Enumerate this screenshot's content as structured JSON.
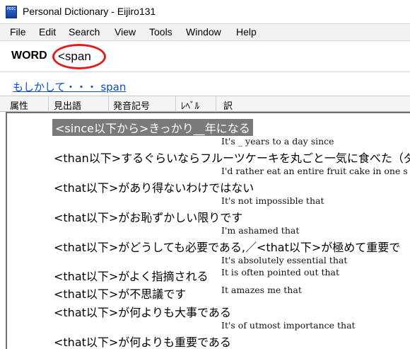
{
  "window": {
    "title": "Personal Dictionary - Eijiro131",
    "icon_label": "PDIC"
  },
  "menu": [
    "File",
    "Edit",
    "Search",
    "View",
    "Tools",
    "Window",
    "Help"
  ],
  "search": {
    "label": "WORD",
    "value": "<span",
    "annotation_color": "#e41b1b"
  },
  "suggestion": {
    "text": "もしかして・・・ span"
  },
  "columns": [
    "属性",
    "見出語",
    "発音記号",
    "ﾚﾍﾞﾙ",
    "訳"
  ],
  "entries": [
    {
      "headword": "<since以下から>きっかり__年になる",
      "translation": "It's _ years to a day since",
      "selected": true
    },
    {
      "headword": "<than以下>するぐらいならフルーツケーキを丸ごと一気に食べた（ダイ",
      "translation": "I'd rather eat an entire fruit cake in one s"
    },
    {
      "headword": "<that以下>があり得ないわけではない",
      "translation": "It's not impossible that"
    },
    {
      "headword": "<that以下>がお恥ずかしい限りです",
      "translation": "I'm ashamed that"
    },
    {
      "headword": "<that以下>がどうしても必要である,／<that以下>が極めて重要で",
      "translation": "It's absolutely essential that"
    },
    {
      "headword": "<that以下>がよく指摘される",
      "translation": "It is often pointed out that"
    },
    {
      "headword": "<that以下>が不思議です",
      "translation": "It amazes me that"
    },
    {
      "headword": "<that以下>が何よりも大事である",
      "translation": "It's of utmost importance that"
    },
    {
      "headword": "<that以下>が何よりも重要である",
      "translation": ""
    }
  ],
  "colors": {
    "selected_bg": "#7a7a7a",
    "link": "#0b4cc7"
  }
}
